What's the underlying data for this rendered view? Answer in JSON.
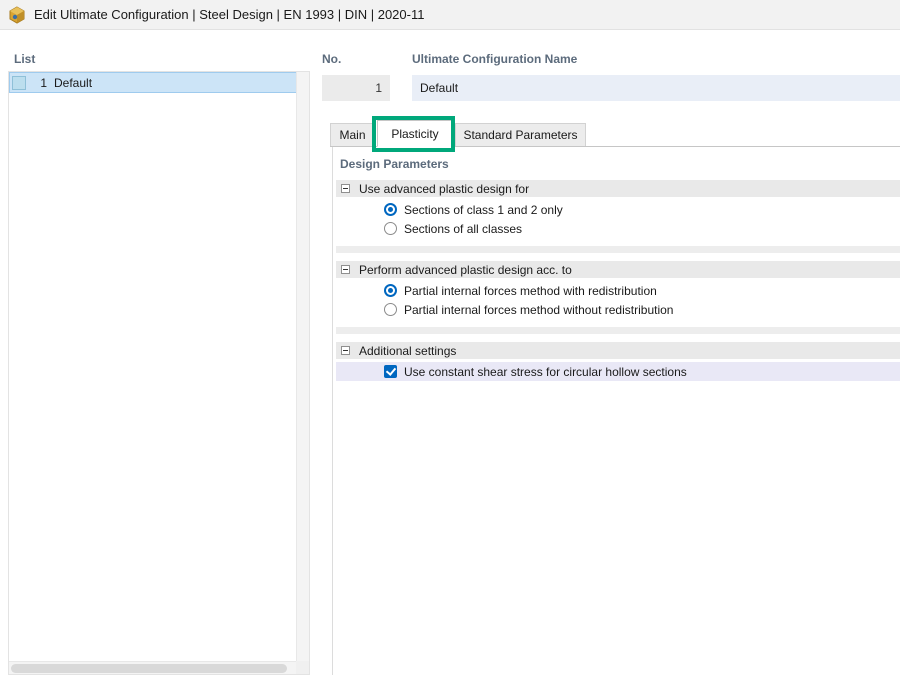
{
  "window": {
    "title": "Edit Ultimate Configuration | Steel Design | EN 1993 | DIN | 2020-11"
  },
  "list_panel": {
    "header": "List",
    "items": [
      {
        "no": "1",
        "name": "Default",
        "selected": true
      }
    ]
  },
  "config": {
    "no_label": "No.",
    "no_value": "1",
    "name_label": "Ultimate Configuration Name",
    "name_value": "Default"
  },
  "tabs": [
    {
      "label": "Main",
      "active": false
    },
    {
      "label": "Plasticity",
      "active": true,
      "annotated": true
    },
    {
      "label": "Standard Parameters",
      "active": false
    }
  ],
  "content": {
    "section_title": "Design Parameters",
    "groups": [
      {
        "header": "Use advanced plastic design for",
        "options": [
          {
            "type": "radio",
            "label": "Sections of class 1 and 2 only",
            "checked": true
          },
          {
            "type": "radio",
            "label": "Sections of all classes",
            "checked": false
          }
        ]
      },
      {
        "header": "Perform advanced plastic design acc. to",
        "options": [
          {
            "type": "radio",
            "label": "Partial internal forces method with redistribution",
            "checked": true
          },
          {
            "type": "radio",
            "label": "Partial internal forces method without redistribution",
            "checked": false
          }
        ]
      },
      {
        "header": "Additional settings",
        "options": [
          {
            "type": "checkbox",
            "label": "Use constant shear stress for circular hollow sections",
            "checked": true,
            "highlighted": true
          }
        ]
      }
    ]
  },
  "colors": {
    "annotation_green": "#00a87b",
    "control_blue": "#0067c0",
    "selection_blue": "#cce4f7",
    "header_text": "#5c6b7c",
    "group_header_bg": "#e9e9e9",
    "highlight_row_bg": "#e9e8f6"
  }
}
